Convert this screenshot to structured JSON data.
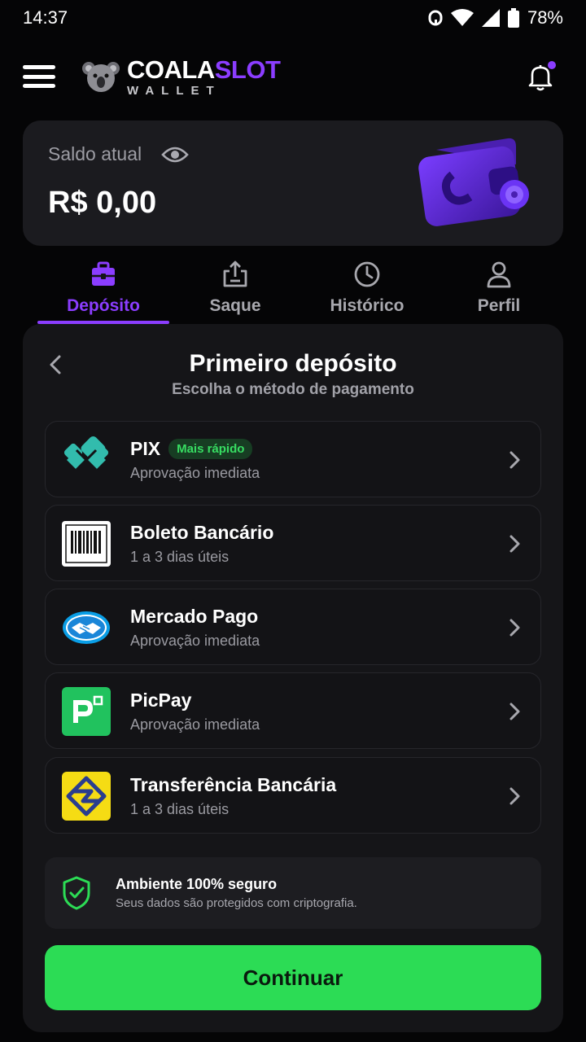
{
  "status_bar": {
    "time": "14:37",
    "battery": "78%"
  },
  "header": {
    "logo_part1": "COALA",
    "logo_part2": "SLOT",
    "logo_sub": "WALLET",
    "notification_dot_color": "#8b3dff"
  },
  "balance": {
    "label": "Saldo atual",
    "value": "R$ 0,00"
  },
  "tabs": [
    {
      "label": "Depósito",
      "icon": "deposit-icon",
      "active": true
    },
    {
      "label": "Saque",
      "icon": "withdraw-icon",
      "active": false
    },
    {
      "label": "Histórico",
      "icon": "clock-icon",
      "active": false
    },
    {
      "label": "Perfil",
      "icon": "user-icon",
      "active": false
    }
  ],
  "panel": {
    "title": "Primeiro depósito",
    "subtitle": "Escolha o método de pagamento"
  },
  "methods": [
    {
      "name": "PIX",
      "badge": "Mais rápido",
      "desc": "Aprovação imediata",
      "icon": "pix-icon"
    },
    {
      "name": "Boleto Bancário",
      "desc": "1 a 3 dias úteis",
      "icon": "barcode-icon"
    },
    {
      "name": "Mercado Pago",
      "desc": "Aprovação imediata",
      "icon": "mercado-pago-icon"
    },
    {
      "name": "PicPay",
      "desc": "Aprovação imediata",
      "icon": "picpay-icon"
    },
    {
      "name": "Transferência Bancária",
      "desc": "1 a 3 dias úteis",
      "icon": "bank-icon"
    }
  ],
  "secure": {
    "title": "Ambiente 100% seguro",
    "desc": "Seus dados são protegidos com criptografia."
  },
  "continue_label": "Continuar",
  "colors": {
    "accent": "#8b3dff",
    "primary_button": "#2cdc55",
    "badge_green": "#37dd62"
  }
}
